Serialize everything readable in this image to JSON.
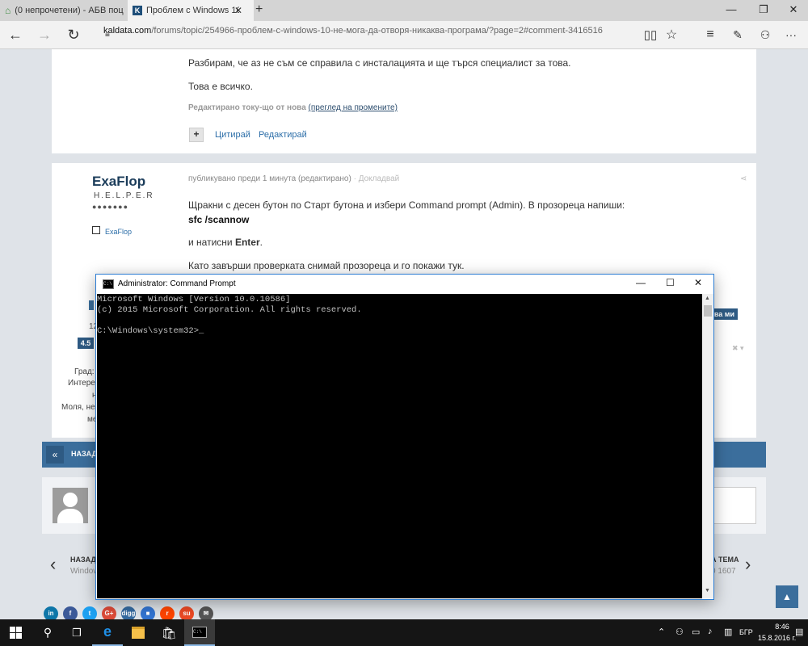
{
  "browser": {
    "tabs": [
      {
        "title": "(0 непрочетени) - АБВ поц",
        "active": false
      },
      {
        "title": "Проблем с Windows 10",
        "active": true
      }
    ],
    "url_domain": "kaldata.com",
    "url_path": "/forums/topic/254966-проблем-с-windows-10-не-мога-да-отворя-никаква-програма/?page=2#comment-3416516"
  },
  "post1": {
    "line1": "Разбирам, че аз не съм се справила с инсталацията и ще търся специалист за това.",
    "line2": "Това е всичко.",
    "edited_prefix": "Редактирано току-що от нова",
    "edited_link": "(преглед на промените)",
    "quote": "Цитирай",
    "edit": "Редактирай"
  },
  "post2": {
    "author": "ExaFlop",
    "rank": "H.E.L.P.E.R",
    "pips": "●●●●●●●",
    "profile_link": "ExaFlop",
    "meta": "публикувано преди 1 минута (редактирано)",
    "report": "· Докладвай",
    "line1": "Щракни с десен бутон по Старт бутона и избери Command prompt (Admin). В прозореца напиши:",
    "command": "sfc /scannow",
    "enter_prefix": "и натисни ",
    "enter_key": "Enter",
    "enter_suffix": ".",
    "line3": "Като завърши проверката снимай прозореца и го покажи тук.",
    "sidebar_partial": {
      "rating": "4.5",
      "count": "12",
      "city": "Град:",
      "interests": "Интере",
      "n": "н",
      "please": "Моля, не",
      "me": "ме"
    },
    "badge_partial": "есва ми"
  },
  "pager": {
    "back_label": "НАЗАД"
  },
  "topic_nav": {
    "prev_label": "НАЗАД",
    "prev_sub": "Window",
    "next_label": "А ТЕМА",
    "next_sub": "0 1607"
  },
  "cmd": {
    "title": "Administrator: Command Prompt",
    "lines": [
      "Microsoft Windows [Version 10.0.10586]",
      "(c) 2015 Microsoft Corporation. All rights reserved.",
      "",
      "C:\\Windows\\system32>_"
    ]
  },
  "share_buttons": [
    {
      "name": "linkedin",
      "label": "in",
      "color": "#0e76a8"
    },
    {
      "name": "facebook",
      "label": "f",
      "color": "#3b5998"
    },
    {
      "name": "twitter",
      "label": "t",
      "color": "#1da1f2"
    },
    {
      "name": "googleplus",
      "label": "G+",
      "color": "#dd4b39"
    },
    {
      "name": "digg",
      "label": "digg",
      "color": "#356aa0"
    },
    {
      "name": "delicious",
      "label": "■",
      "color": "#3274d1"
    },
    {
      "name": "reddit",
      "label": "r",
      "color": "#ff4500"
    },
    {
      "name": "stumbleupon",
      "label": "su",
      "color": "#eb4924"
    },
    {
      "name": "email",
      "label": "✉",
      "color": "#555555"
    }
  ],
  "taskbar": {
    "language": "БГР",
    "time": "8:46",
    "date": "15.8.2016 г."
  }
}
